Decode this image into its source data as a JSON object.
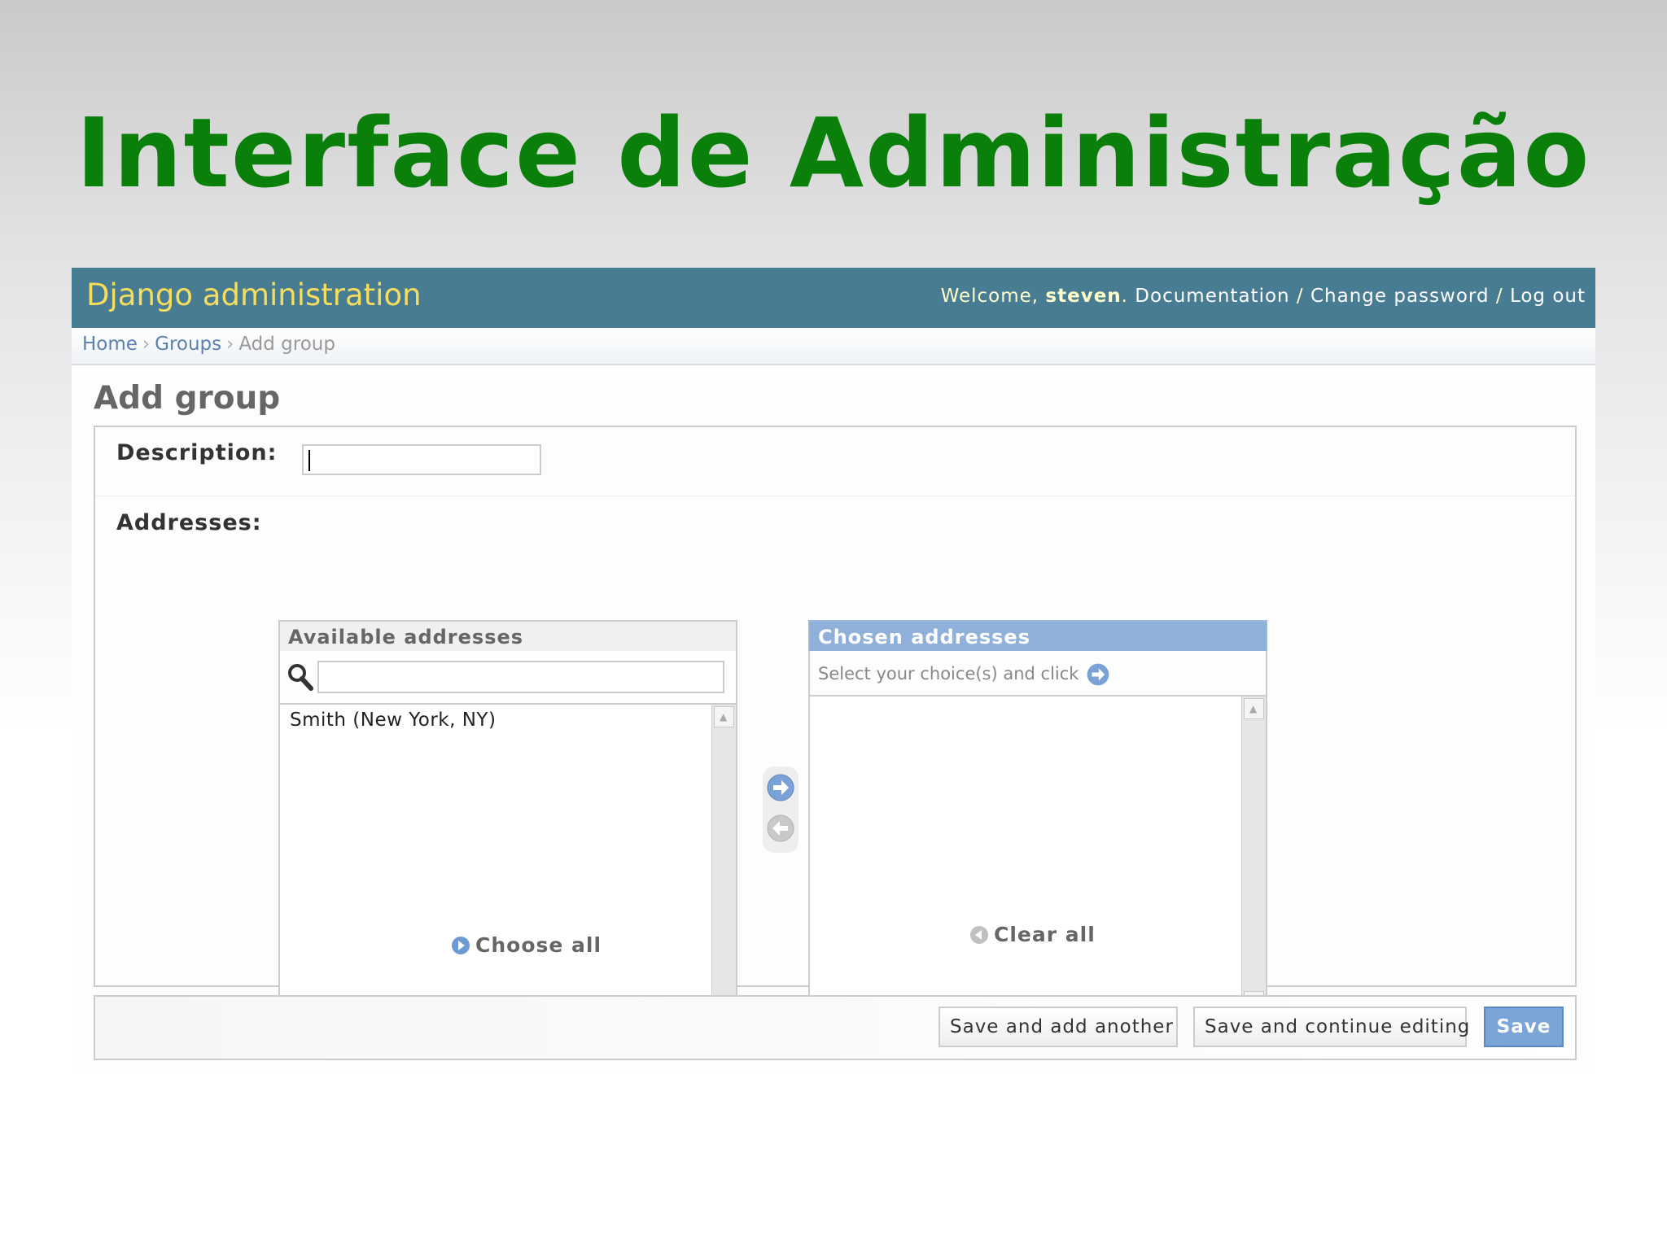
{
  "slide": {
    "title": "Interface de Administração"
  },
  "header": {
    "branding": "Django administration",
    "welcome_prefix": "Welcome, ",
    "username": "steven",
    "welcome_suffix": ". ",
    "documentation": "Documentation",
    "separator": " / ",
    "change_password": "Change password",
    "log_out": "Log out"
  },
  "breadcrumbs": {
    "home": "Home",
    "sep": "›",
    "groups": "Groups",
    "current": "Add group"
  },
  "page": {
    "heading": "Add group"
  },
  "form": {
    "description_label": "Description:",
    "description_value": "",
    "addresses_label": "Addresses:"
  },
  "selector": {
    "available_title": "Available addresses",
    "available_filter_value": "",
    "available_items": [
      "Smith (New York, NY)"
    ],
    "chosen_title": "Chosen addresses",
    "chosen_help": "Select your choice(s) and click",
    "chosen_items": [],
    "choose_all": "Choose all",
    "clear_all": "Clear all"
  },
  "submit_row": {
    "save_add_another": "Save and add another",
    "save_continue": "Save and continue editing",
    "save": "Save"
  },
  "colors": {
    "title_green": "#0a7f0a",
    "header_bg": "#487c93",
    "branding_yellow": "#f5dd5d",
    "link_blue": "#5b80b2",
    "chosen_header": "#8fb0d9",
    "save_button": "#7aa5d6"
  },
  "icons": {
    "search": "magnifier-icon",
    "add_arrow": "arrow-right-circle-icon",
    "remove_arrow": "arrow-left-circle-icon",
    "scroll_up": "triangle-up",
    "scroll_down": "triangle-down"
  }
}
